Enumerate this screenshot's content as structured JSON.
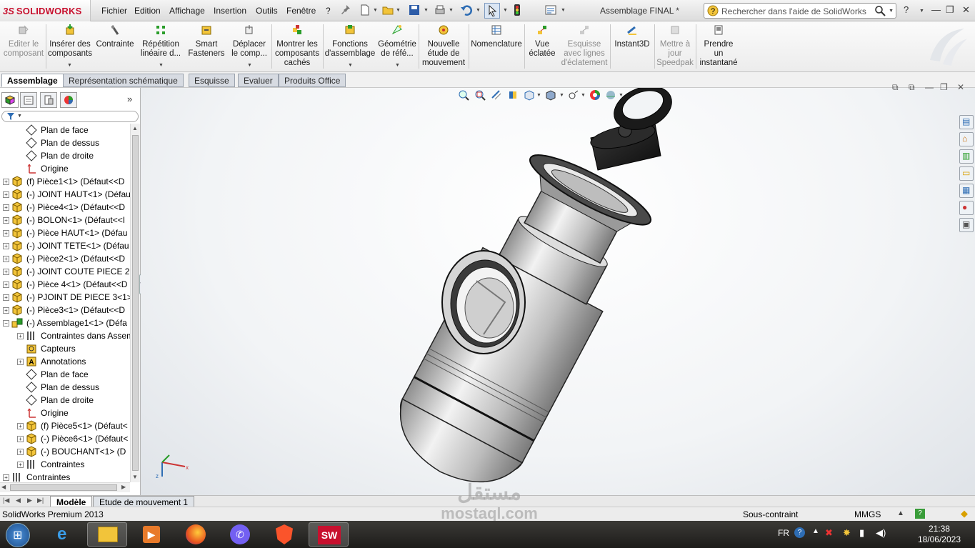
{
  "app": {
    "brand": "SOLIDWORKS",
    "document_title": "Assemblage FINAL *",
    "colors": {
      "brand": "#c8102e",
      "accent": "#2e6db4"
    }
  },
  "menu": [
    "Fichier",
    "Edition",
    "Affichage",
    "Insertion",
    "Outils",
    "Fenêtre",
    "?"
  ],
  "search": {
    "placeholder": "Rechercher dans l'aide de SolidWorks"
  },
  "commands": [
    {
      "label": "Editer le\ncomposant",
      "icon": "edit-component-icon",
      "enabled": false
    },
    {
      "label": "Insérer des\ncomposants",
      "icon": "insert-components-icon",
      "enabled": true
    },
    {
      "label": "Contrainte",
      "icon": "mate-icon",
      "enabled": true
    },
    {
      "label": "Répétition\nlinéaire d...",
      "icon": "linear-pattern-icon",
      "enabled": true
    },
    {
      "label": "Smart\nFasteners",
      "icon": "smart-fasteners-icon",
      "enabled": true
    },
    {
      "label": "Déplacer\nle comp...",
      "icon": "move-component-icon",
      "enabled": true
    },
    {
      "label": "Montrer les\ncomposants\ncachés",
      "icon": "show-hidden-icon",
      "enabled": true
    },
    {
      "label": "Fonctions\nd'assemblage",
      "icon": "assembly-features-icon",
      "enabled": true
    },
    {
      "label": "Géométrie\nde réfé...",
      "icon": "reference-geometry-icon",
      "enabled": true
    },
    {
      "label": "Nouvelle\nétude de\nmouvement",
      "icon": "motion-study-icon",
      "enabled": true
    },
    {
      "label": "Nomenclature",
      "icon": "bom-icon",
      "enabled": true
    },
    {
      "label": "Vue\néclatée",
      "icon": "exploded-view-icon",
      "enabled": true
    },
    {
      "label": "Esquisse\navec lignes\nd'éclatement",
      "icon": "explode-line-sketch-icon",
      "enabled": false
    },
    {
      "label": "Instant3D",
      "icon": "instant3d-icon",
      "enabled": true
    },
    {
      "label": "Mettre à\njour\nSpeedpak",
      "icon": "speedpak-icon",
      "enabled": false
    },
    {
      "label": "Prendre\nun\ninstantané",
      "icon": "snapshot-icon",
      "enabled": true
    }
  ],
  "tabs": [
    "Assemblage",
    "Représentation schématique",
    "Esquisse",
    "Evaluer",
    "Produits Office"
  ],
  "tree": [
    {
      "label": "Plan de face",
      "icon": "plane-icon",
      "level": 1,
      "exp": ""
    },
    {
      "label": "Plan de dessus",
      "icon": "plane-icon",
      "level": 1,
      "exp": ""
    },
    {
      "label": "Plan de droite",
      "icon": "plane-icon",
      "level": 1,
      "exp": ""
    },
    {
      "label": "Origine",
      "icon": "origin-icon",
      "level": 1,
      "exp": ""
    },
    {
      "label": "(f) Pièce1<1> (Défaut<<D",
      "icon": "part-icon",
      "level": 0,
      "exp": "+"
    },
    {
      "label": "(-) JOINT HAUT<1> (Défau",
      "icon": "part-icon",
      "level": 0,
      "exp": "+"
    },
    {
      "label": "(-) Pièce4<1> (Défaut<<D",
      "icon": "part-icon",
      "level": 0,
      "exp": "+"
    },
    {
      "label": "(-) BOLON<1> (Défaut<<I",
      "icon": "part-icon",
      "level": 0,
      "exp": "+"
    },
    {
      "label": "(-) Pièce HAUT<1> (Défau",
      "icon": "part-icon",
      "level": 0,
      "exp": "+"
    },
    {
      "label": "(-) JOINT TETE<1> (Défau",
      "icon": "part-icon",
      "level": 0,
      "exp": "+"
    },
    {
      "label": "(-) Pièce2<1> (Défaut<<D",
      "icon": "part-icon",
      "level": 0,
      "exp": "+"
    },
    {
      "label": "(-) JOINT COUTE PIECE 2<",
      "icon": "part-icon",
      "level": 0,
      "exp": "+"
    },
    {
      "label": "(-) Pièce 4<1> (Défaut<<D",
      "icon": "part-icon",
      "level": 0,
      "exp": "+"
    },
    {
      "label": "(-) PJOINT DE PIECE 3<1>",
      "icon": "part-icon",
      "level": 0,
      "exp": "+"
    },
    {
      "label": "(-) Pièce3<1> (Défaut<<D",
      "icon": "part-icon",
      "level": 0,
      "exp": "+"
    },
    {
      "label": "(-) Assemblage1<1> (Défa",
      "icon": "assembly-icon",
      "level": 0,
      "exp": "-"
    },
    {
      "label": "Contraintes dans Assem",
      "icon": "mates-folder-icon",
      "level": 1,
      "exp": "+"
    },
    {
      "label": "Capteurs",
      "icon": "sensor-icon",
      "level": 1,
      "exp": ""
    },
    {
      "label": "Annotations",
      "icon": "annotation-icon",
      "level": 1,
      "exp": "+"
    },
    {
      "label": "Plan de face",
      "icon": "plane-icon",
      "level": 1,
      "exp": ""
    },
    {
      "label": "Plan de dessus",
      "icon": "plane-icon",
      "level": 1,
      "exp": ""
    },
    {
      "label": "Plan de droite",
      "icon": "plane-icon",
      "level": 1,
      "exp": ""
    },
    {
      "label": "Origine",
      "icon": "origin-icon",
      "level": 1,
      "exp": ""
    },
    {
      "label": "(f) Pièce5<1> (Défaut<",
      "icon": "part-icon",
      "level": 1,
      "exp": "+"
    },
    {
      "label": "(-) Pièce6<1> (Défaut<",
      "icon": "part-icon",
      "level": 1,
      "exp": "+"
    },
    {
      "label": "(-) BOUCHANT<1> (D",
      "icon": "part-icon",
      "level": 1,
      "exp": "+"
    },
    {
      "label": "Contraintes",
      "icon": "mates-folder-icon",
      "level": 1,
      "exp": "+"
    },
    {
      "label": "Contraintes",
      "icon": "mates-folder-icon",
      "level": 0,
      "exp": "+"
    }
  ],
  "bottom_tabs": [
    "Modèle",
    "Etude de mouvement 1"
  ],
  "status": {
    "product": "SolidWorks Premium 2013",
    "constraint_state": "Sous-contraint",
    "units": "MMGS"
  },
  "taskbar": {
    "apps": [
      "windows-start-icon",
      "internet-explorer-icon",
      "file-explorer-icon",
      "media-player-icon",
      "firefox-icon",
      "viber-icon",
      "brave-icon",
      "solidworks-icon"
    ],
    "language": "FR",
    "time": "21:38",
    "date": "18/06/2023"
  },
  "watermark": {
    "arabic": "مستقل",
    "latin": "mostaql.com"
  }
}
